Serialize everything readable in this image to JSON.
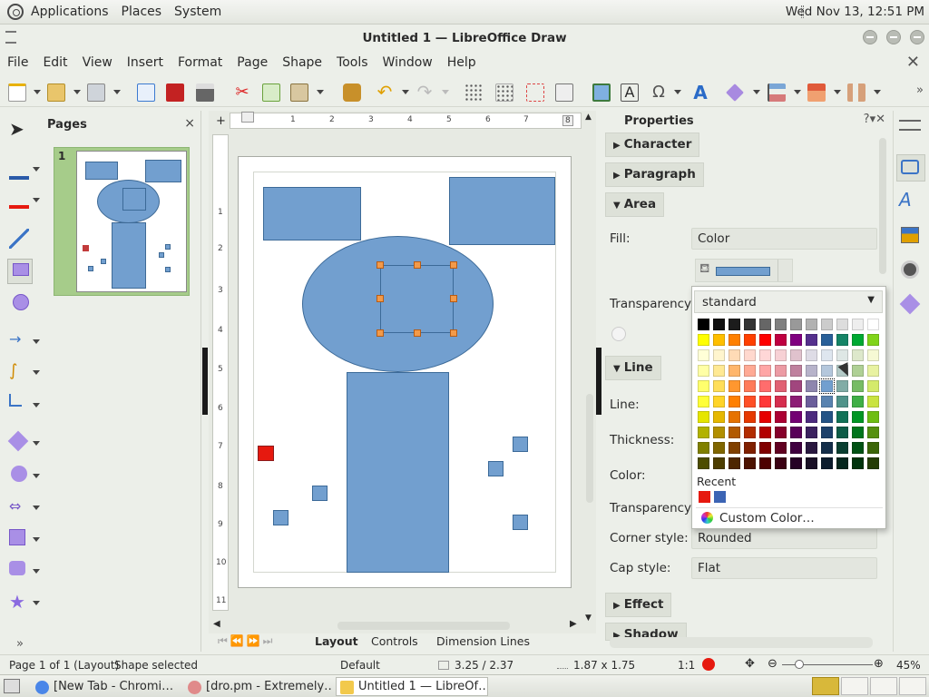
{
  "panel": {
    "apps": "Applications",
    "places": "Places",
    "system": "System",
    "clock": "Wed Nov 13, 12:51 PM"
  },
  "window": {
    "title": "Untitled 1 — LibreOffice Draw"
  },
  "menu": [
    "File",
    "Edit",
    "View",
    "Insert",
    "Format",
    "Page",
    "Shape",
    "Tools",
    "Window",
    "Help"
  ],
  "pages_panel": {
    "title": "Pages",
    "page_number": "1"
  },
  "rulers": {
    "h": [
      "1",
      "1",
      "2",
      "3",
      "4",
      "5",
      "6",
      "7",
      "8"
    ],
    "v": [
      "1",
      "1",
      "2",
      "3",
      "4",
      "5",
      "6",
      "7",
      "8",
      "9",
      "10",
      "11"
    ]
  },
  "tabs": [
    "Layout",
    "Controls",
    "Dimension Lines"
  ],
  "properties": {
    "title": "Properties",
    "sections": {
      "character": "Character",
      "paragraph": "Paragraph",
      "area": "Area",
      "line": "Line",
      "effect": "Effect",
      "shadow": "Shadow"
    },
    "labels": {
      "fill": "Fill:",
      "transparency": "Transparency:",
      "line": "Line:",
      "thickness": "Thickness:",
      "color": "Color:",
      "transparency2": "Transparency:",
      "corner": "Corner style:",
      "cap": "Cap style:"
    },
    "values": {
      "fill": "Color",
      "corner": "Rounded",
      "cap": "Flat"
    }
  },
  "color_popup": {
    "palette": "standard",
    "recent_label": "Recent",
    "recent_colors": [
      "#e6190f",
      "#3c64b4"
    ],
    "custom": "Custom Color…",
    "rows": [
      [
        "#000000",
        "#111111",
        "#1c1c1c",
        "#333333",
        "#666666",
        "#808080",
        "#999999",
        "#b2b2b2",
        "#cccccc",
        "#dddddd",
        "#eeeeee",
        "#ffffff"
      ],
      [
        "#ffff00",
        "#ffbf00",
        "#ff8000",
        "#ff4000",
        "#ff0000",
        "#bf0041",
        "#800080",
        "#55308d",
        "#2a6099",
        "#158466",
        "#00a933",
        "#81d41a"
      ],
      [
        "#ffffd7",
        "#fff5ce",
        "#ffdbb6",
        "#ffd8ce",
        "#ffd7d7",
        "#f7d1d5",
        "#e0c2cd",
        "#dedce6",
        "#dee6ef",
        "#dee7e5",
        "#dde8cb",
        "#f6f9d4"
      ],
      [
        "#ffffa6",
        "#ffe994",
        "#ffb66c",
        "#ffaa95",
        "#ffa6a6",
        "#ec9ba4",
        "#bf819e",
        "#b7b3ca",
        "#b4c7dc",
        "#b3cac7",
        "#afd095",
        "#e8f2a1"
      ],
      [
        "#ffff6d",
        "#ffde59",
        "#ff972f",
        "#ff7b59",
        "#ff6d6d",
        "#e16173",
        "#a1467e",
        "#8e86ae",
        "#729fcf",
        "#81aca6",
        "#77bc65",
        "#d4ea6b"
      ],
      [
        "#ffff38",
        "#ffd428",
        "#ff8000",
        "#ff4f26",
        "#ff3838",
        "#d62e4e",
        "#8d1d75",
        "#6b5e9b",
        "#5983b0",
        "#50938a",
        "#3faf46",
        "#c9e340"
      ],
      [
        "#e6e600",
        "#e6b800",
        "#e67300",
        "#e63900",
        "#e60000",
        "#ac0033",
        "#730073",
        "#4c2a7e",
        "#255486",
        "#127257",
        "#009624",
        "#6ebe14"
      ],
      [
        "#b2b200",
        "#b28f00",
        "#b25a00",
        "#b22d00",
        "#b20000",
        "#86002b",
        "#590059",
        "#3b215f",
        "#1d416b",
        "#0e5c47",
        "#00751c",
        "#559010"
      ],
      [
        "#808000",
        "#806600",
        "#804000",
        "#802000",
        "#800000",
        "#610021",
        "#400040",
        "#2a1840",
        "#142e4a",
        "#0a3f31",
        "#005214",
        "#3c6609"
      ],
      [
        "#4d4d00",
        "#4d3d00",
        "#4d2600",
        "#4d1300",
        "#4d0000",
        "#3b0013",
        "#260026",
        "#1a0f26",
        "#0c1c2d",
        "#06271e",
        "#00330c",
        "#243d05"
      ]
    ]
  },
  "status": {
    "page": "Page 1 of 1 (Layout)",
    "selection": "Shape selected",
    "style": "Default",
    "position": "3.25 / 2.37",
    "size": "1.87 x 1.75",
    "scale": "1:1",
    "zoom": "45%"
  },
  "taskbar": [
    {
      "label": "[New Tab - Chromi…",
      "color": "#4a86e8"
    },
    {
      "label": "[dro.pm - Extremely…",
      "color": "#e08a8a"
    },
    {
      "label": "Untitled 1 — LibreOf…",
      "color": "#f2c94c"
    }
  ]
}
